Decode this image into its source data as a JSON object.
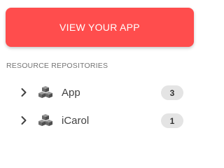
{
  "cta": {
    "label": "VIEW YOUR APP",
    "color": "#ff4d4d"
  },
  "section": {
    "label": "RESOURCE REPOSITORIES"
  },
  "repositories": [
    {
      "label": "App",
      "count": "3",
      "icon": "boxes-icon",
      "expander_icon": "chevron-right-icon"
    },
    {
      "label": "iCarol",
      "count": "1",
      "icon": "boxes-icon",
      "expander_icon": "chevron-right-icon"
    }
  ],
  "colors": {
    "icon": "#6b6b6b",
    "badge_bg": "#e4e4e4"
  }
}
